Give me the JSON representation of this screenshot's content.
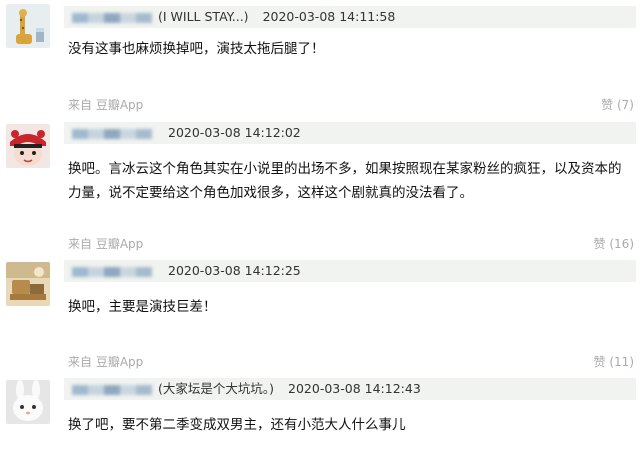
{
  "comments": [
    {
      "author": "        ",
      "author_note": "(I WILL STAY...)",
      "timestamp": "2020-03-08 14:11:58",
      "text": "没有这事也麻烦换掉吧，演技太拖后腿了！",
      "source": "来自 豆瓣App",
      "likes": "赞 (7)"
    },
    {
      "author": "        ",
      "author_note": "",
      "timestamp": "2020-03-08 14:12:02",
      "text": "换吧。言冰云这个角色其实在小说里的出场不多，如果按照现在某家粉丝的疯狂，以及资本的力量，说不定要给这个角色加戏很多，这样这个剧就真的没法看了。",
      "source": "来自 豆瓣App",
      "likes": "赞 (16)"
    },
    {
      "author": "        ",
      "author_note": "",
      "timestamp": "2020-03-08 14:12:25",
      "text": "换吧，主要是演技巨差！",
      "source": "来自 豆瓣App",
      "likes": "赞 (11)"
    },
    {
      "author": "     ",
      "author_note": "(大家坛是个大坑坑。)",
      "timestamp": "2020-03-08 14:12:43",
      "text": "换了吧，要不第二季变成双男主，还有小范大人什么事儿",
      "source": "",
      "likes": ""
    }
  ],
  "colors": {
    "header_bg": "#f0f3f0",
    "author": "#3377aa",
    "meta": "#aaaaaa"
  }
}
